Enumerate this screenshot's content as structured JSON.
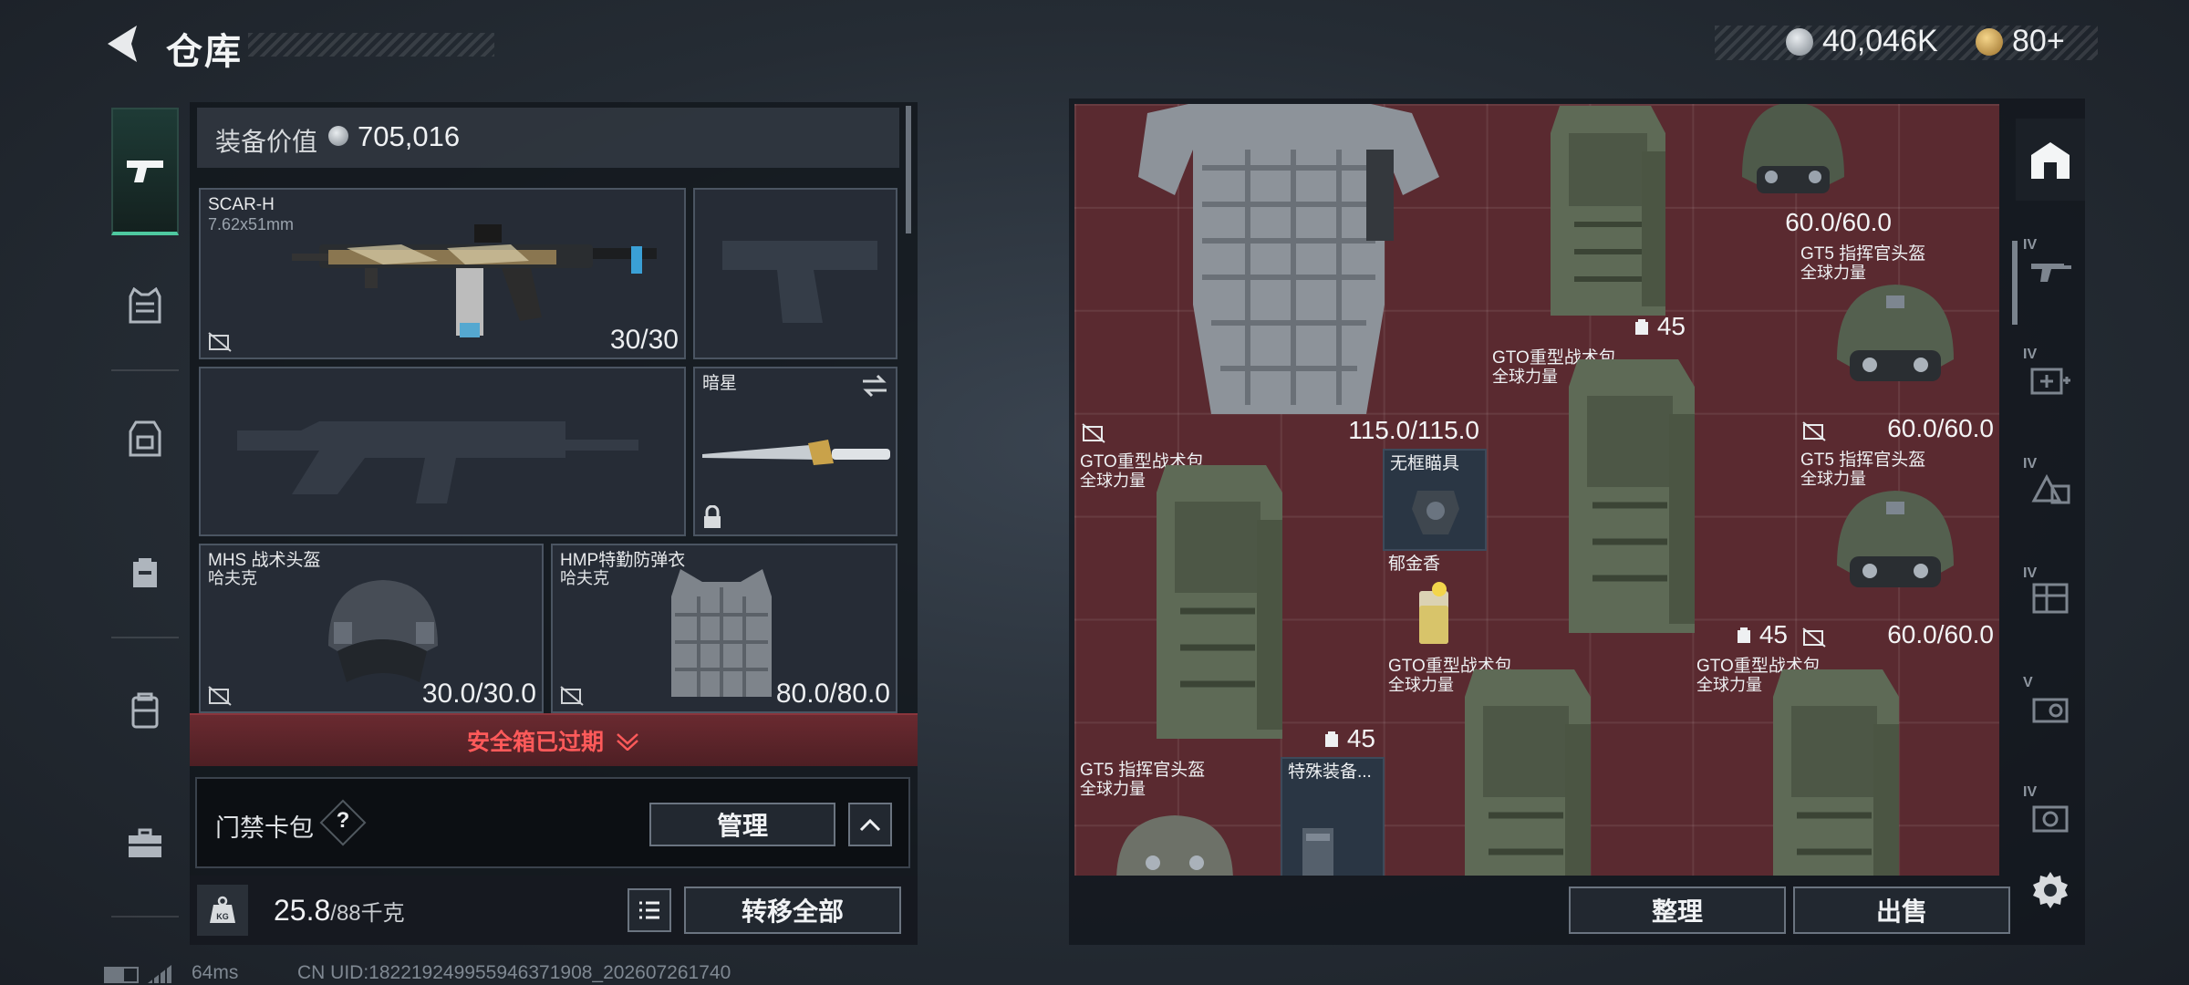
{
  "header": {
    "title": "仓库",
    "currency_main": "40,046K",
    "currency_secondary": "80+"
  },
  "loadout": {
    "equipment_value_label": "装备价值",
    "equipment_value": "705,016",
    "primary_weapon": {
      "name": "SCAR-H",
      "caliber": "7.62x51mm",
      "ammo": "30/30"
    },
    "melee": {
      "name": "暗星"
    },
    "helmet": {
      "name": "MHS 战术头盔",
      "brand": "哈夫克",
      "durability": "30.0/30.0"
    },
    "armor": {
      "name": "HMP特勤防弹衣",
      "brand": "哈夫克",
      "durability": "80.0/80.0"
    },
    "safe_box_status": "安全箱已过期",
    "keycard_label": "门禁卡包",
    "keycard_help": "?",
    "manage_label": "管理",
    "weight_current": "25.8",
    "weight_max": "/88千克",
    "transfer_all_label": "转移全部"
  },
  "storage": {
    "items": [
      {
        "durability": "115.0/115.0"
      },
      {
        "count": "45"
      },
      {
        "durability": "60.0/60.0"
      },
      {
        "name": "GT5 指挥官头盔",
        "brand": "全球力量",
        "durability": "60.0/60.0"
      },
      {
        "name": "GTO重型战术包",
        "brand": "全球力量",
        "count": "45"
      },
      {
        "name": "GTO重型战术包",
        "brand": "全球力量",
        "count": "45"
      },
      {
        "name": "无框瞄具"
      },
      {
        "name": "郁金香"
      },
      {
        "name": "GT5 指挥官头盔",
        "brand": "全球力量",
        "durability": "60.0/60.0"
      },
      {
        "name": "GTO重型战术包",
        "brand": "全球力量"
      },
      {
        "name": "GTO重型战术包",
        "brand": "全球力量"
      },
      {
        "name": "GT5 指挥官头盔",
        "brand": "全球力量"
      },
      {
        "name": "特殊装备..."
      }
    ],
    "sort_label": "整理",
    "sell_label": "出售"
  },
  "right_tabs": [
    "IV",
    "IV",
    "IV",
    "IV",
    "V",
    "IV"
  ],
  "status": {
    "ping": "64ms",
    "uid": "CN UID:18221924995594637190​8_202607261740"
  },
  "colors": {
    "grid_bg": "#5a2a30",
    "accent_green": "#4ec9a0",
    "warning_red": "#ff5a5a"
  }
}
